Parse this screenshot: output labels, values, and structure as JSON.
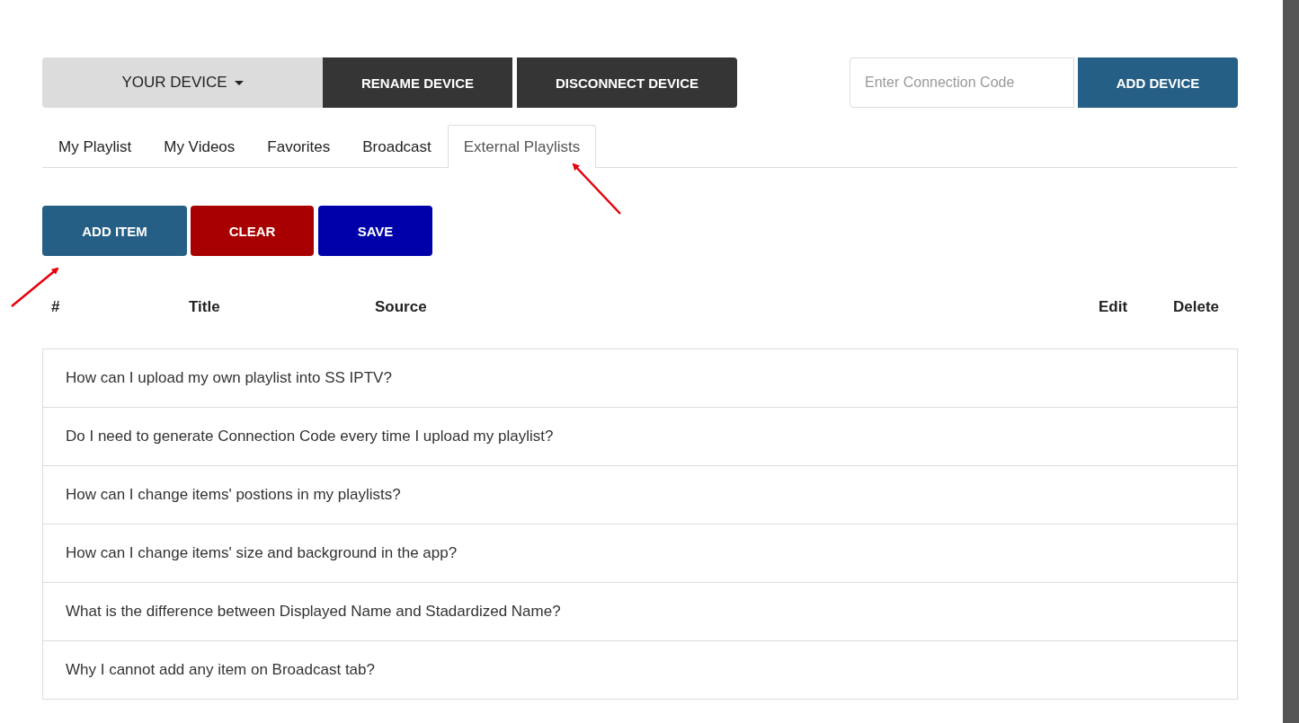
{
  "device_bar": {
    "device_menu": "YOUR DEVICE",
    "buttons": [
      "RENAME DEVICE",
      "DISCONNECT DEVICE"
    ],
    "connection_code": {
      "placeholder": "Enter Connection Code"
    },
    "add_button": "ADD DEVICE"
  },
  "tabs": [
    {
      "label": "My Playlist",
      "selected": false
    },
    {
      "label": "My Videos",
      "selected": false
    },
    {
      "label": "Favorites",
      "selected": false
    },
    {
      "label": "Broadcast",
      "selected": false
    },
    {
      "label": "External Playlists",
      "selected": true
    }
  ],
  "actions": [
    {
      "label": "ADD ITEM",
      "kind": "primary"
    },
    {
      "label": "CLEAR",
      "kind": "danger"
    },
    {
      "label": "SAVE",
      "kind": "save"
    }
  ],
  "table": {
    "columns": [
      "#",
      "Title",
      "Source",
      "Edit",
      "Delete"
    ]
  },
  "faq": [
    "How can I upload my own playlist into SS IPTV?",
    "Do I need to generate Connection Code every time I upload my playlist?",
    "How can I change items' postions in my playlists?",
    "How can I change items' size and background in the app?",
    "What is the difference between Displayed Name and Stadardized Name?",
    "Why I cannot add any item on Broadcast tab?"
  ]
}
